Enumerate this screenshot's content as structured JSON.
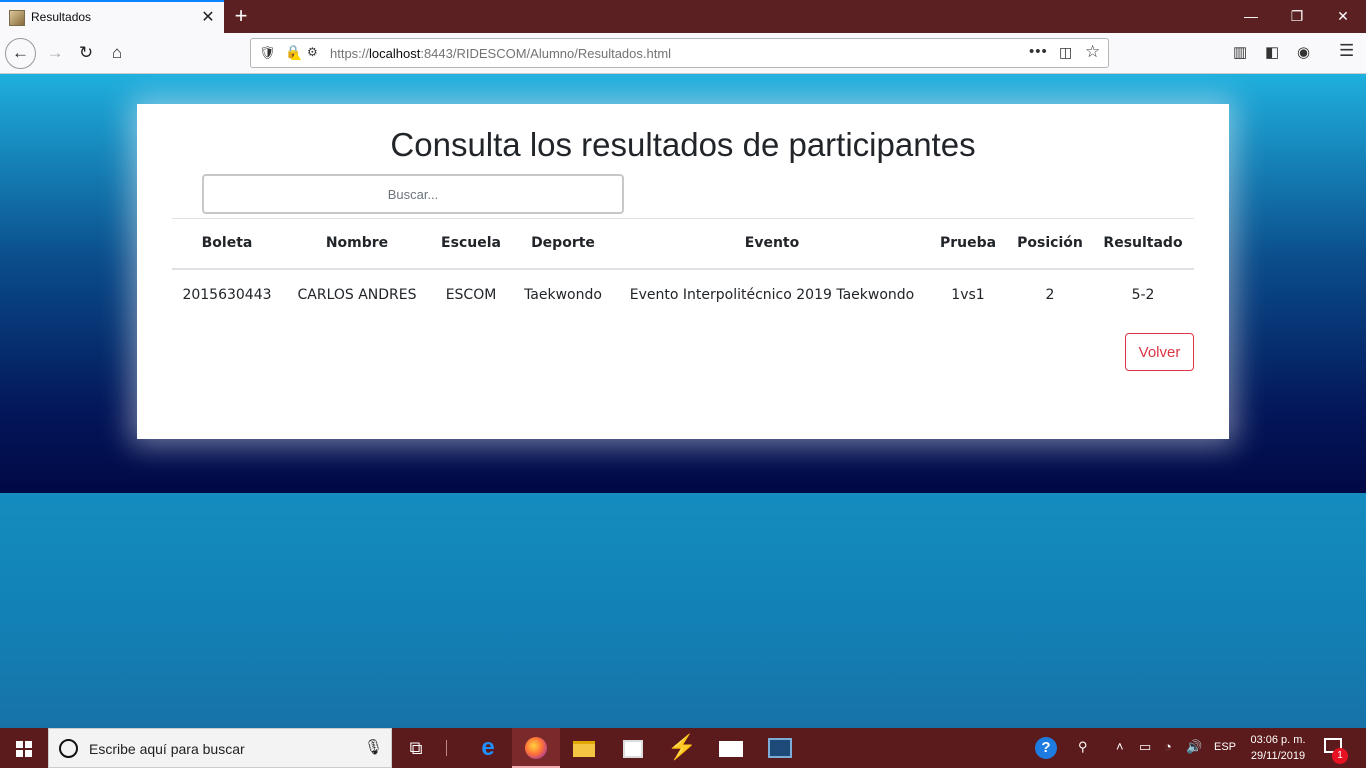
{
  "browser": {
    "tab_title": "Resultados",
    "url_prefix": "https://",
    "url_host": "localhost",
    "url_rest": ":8443/RIDESCOM/Alumno/Resultados.html",
    "url_more": "•••"
  },
  "page": {
    "title": "Consulta los resultados de participantes",
    "search_placeholder": "Buscar...",
    "table": {
      "headers": [
        "Boleta",
        "Nombre",
        "Escuela",
        "Deporte",
        "Evento",
        "Prueba",
        "Posición",
        "Resultado"
      ],
      "rows": [
        [
          "2015630443",
          "CARLOS ANDRES",
          "ESCOM",
          "Taekwondo",
          "Evento Interpolitécnico 2019 Taekwondo",
          "1vs1",
          "2",
          "5-2"
        ]
      ]
    },
    "back_button": "Volver"
  },
  "taskbar": {
    "search_placeholder": "Escribe aquí para buscar",
    "language": "ESP",
    "time": "03:06 p. m.",
    "date": "29/11/2019",
    "notification_count": "1",
    "help_glyph": "?"
  }
}
